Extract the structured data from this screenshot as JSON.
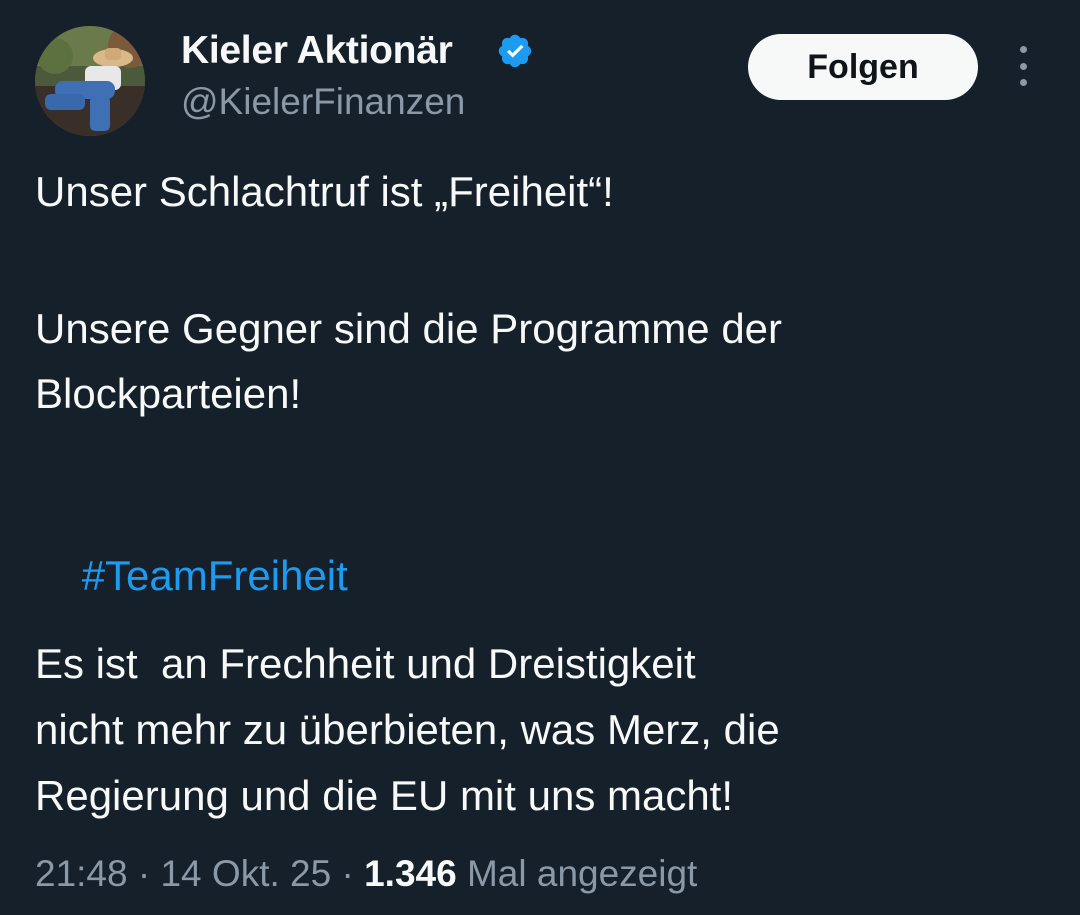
{
  "author": {
    "display_name": "Kieler Aktionär",
    "handle": "@KielerFinanzen",
    "verified_icon": "verified-badge-icon",
    "avatar_icon": "avatar-photo"
  },
  "actions": {
    "follow_label": "Folgen",
    "more_icon": "more-vertical-icon"
  },
  "tweet": {
    "line1": "Unser Schlachtruf ist „Freiheit“!",
    "line2": "Unsere Gegner sind die Programme der",
    "line3": "Blockparteien!",
    "hashtag": "#TeamFreiheit",
    "line4": "Es ist  an Frechheit und Dreistigkeit",
    "line5": "nicht mehr zu überbieten, was Merz, die",
    "line6": "Regierung und die EU mit uns macht!"
  },
  "meta": {
    "time": "21:48",
    "separator": " · ",
    "date": "14 Okt. 25",
    "views_count": "1.346",
    "views_label": " Mal angezeigt"
  },
  "colors": {
    "background": "#15202b",
    "text": "#f7f9f9",
    "secondary_text": "#8b98a5",
    "link": "#1d9bf0",
    "verified": "#1d9bf0"
  }
}
